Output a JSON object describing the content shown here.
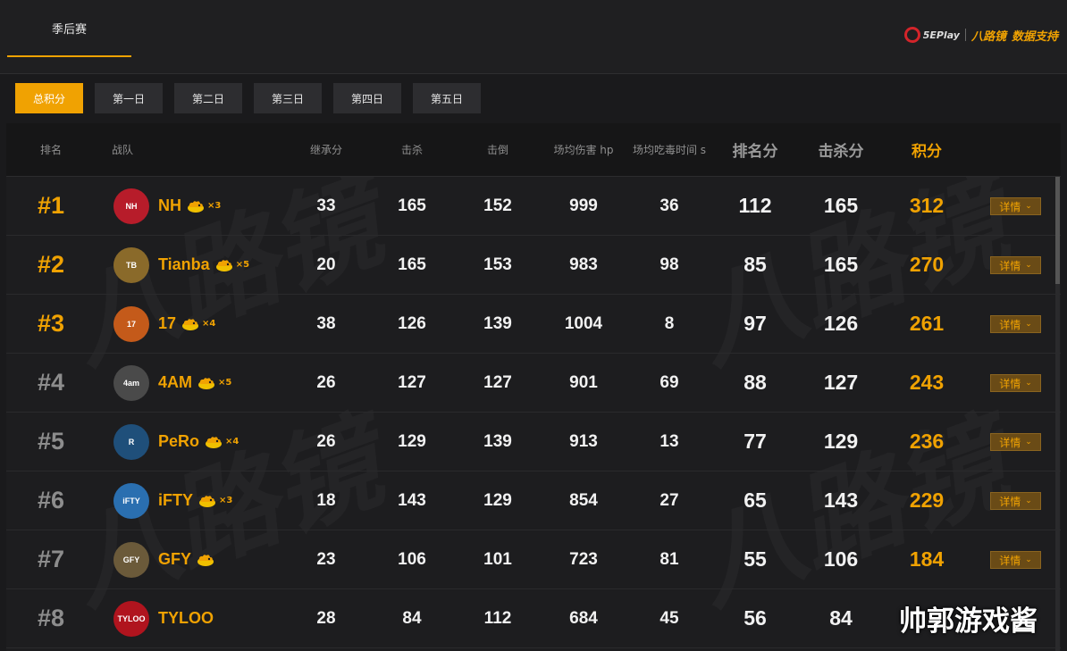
{
  "header": {
    "season_tab": "季后赛",
    "brand_5e": "5EPlay",
    "brand_zbj": "八路镜",
    "brand_support": "数据支持"
  },
  "day_tabs": [
    {
      "label": "总积分",
      "active": true
    },
    {
      "label": "第一日",
      "active": false
    },
    {
      "label": "第二日",
      "active": false
    },
    {
      "label": "第三日",
      "active": false
    },
    {
      "label": "第四日",
      "active": false
    },
    {
      "label": "第五日",
      "active": false
    }
  ],
  "table": {
    "columns": {
      "rank": "排名",
      "team": "战队",
      "inherit": "继承分",
      "kills": "击杀",
      "knocks": "击倒",
      "avg_damage": "场均伤害 hp",
      "avg_poison": "场均吃毒时间 s",
      "rank_pts": "排名分",
      "kill_pts": "击杀分",
      "total": "积分"
    },
    "detail_label": "详情",
    "rows": [
      {
        "rank": "#1",
        "team": "NH",
        "logo": "NH",
        "logo_color": "#b71c2a",
        "chicken": "×3",
        "inherit": "33",
        "kills": "165",
        "knocks": "152",
        "avg_damage": "999",
        "avg_poison": "36",
        "rank_pts": "112",
        "kill_pts": "165",
        "total": "312"
      },
      {
        "rank": "#2",
        "team": "Tianba",
        "logo": "TB",
        "logo_color": "#8a6a2a",
        "chicken": "×5",
        "inherit": "20",
        "kills": "165",
        "knocks": "153",
        "avg_damage": "983",
        "avg_poison": "98",
        "rank_pts": "85",
        "kill_pts": "165",
        "total": "270"
      },
      {
        "rank": "#3",
        "team": "17",
        "logo": "17",
        "logo_color": "#c45a1a",
        "chicken": "×4",
        "inherit": "38",
        "kills": "126",
        "knocks": "139",
        "avg_damage": "1004",
        "avg_poison": "8",
        "rank_pts": "97",
        "kill_pts": "126",
        "total": "261"
      },
      {
        "rank": "#4",
        "team": "4AM",
        "logo": "4am",
        "logo_color": "#4a4a4a",
        "chicken": "×5",
        "inherit": "26",
        "kills": "127",
        "knocks": "127",
        "avg_damage": "901",
        "avg_poison": "69",
        "rank_pts": "88",
        "kill_pts": "127",
        "total": "243"
      },
      {
        "rank": "#5",
        "team": "PeRo",
        "logo": "R",
        "logo_color": "#1f4f7a",
        "chicken": "×4",
        "inherit": "26",
        "kills": "129",
        "knocks": "139",
        "avg_damage": "913",
        "avg_poison": "13",
        "rank_pts": "77",
        "kill_pts": "129",
        "total": "236"
      },
      {
        "rank": "#6",
        "team": "iFTY",
        "logo": "iFTY",
        "logo_color": "#2a6fb0",
        "chicken": "×3",
        "inherit": "18",
        "kills": "143",
        "knocks": "129",
        "avg_damage": "854",
        "avg_poison": "27",
        "rank_pts": "65",
        "kill_pts": "143",
        "total": "229"
      },
      {
        "rank": "#7",
        "team": "GFY",
        "logo": "GFY",
        "logo_color": "#6b5a3a",
        "chicken": "",
        "inherit": "23",
        "kills": "106",
        "knocks": "101",
        "avg_damage": "723",
        "avg_poison": "81",
        "rank_pts": "55",
        "kill_pts": "106",
        "total": "184"
      },
      {
        "rank": "#8",
        "team": "TYLOO",
        "logo": "TYLOO",
        "logo_color": "#b0141e",
        "chicken": "",
        "inherit": "28",
        "kills": "84",
        "knocks": "112",
        "avg_damage": "684",
        "avg_poison": "45",
        "rank_pts": "56",
        "kill_pts": "84",
        "total": ""
      }
    ]
  },
  "overlay_text": "帅郭游戏酱",
  "colors": {
    "accent": "#f0a202",
    "background": "#1a1a1c",
    "header_bg": "#161617"
  }
}
